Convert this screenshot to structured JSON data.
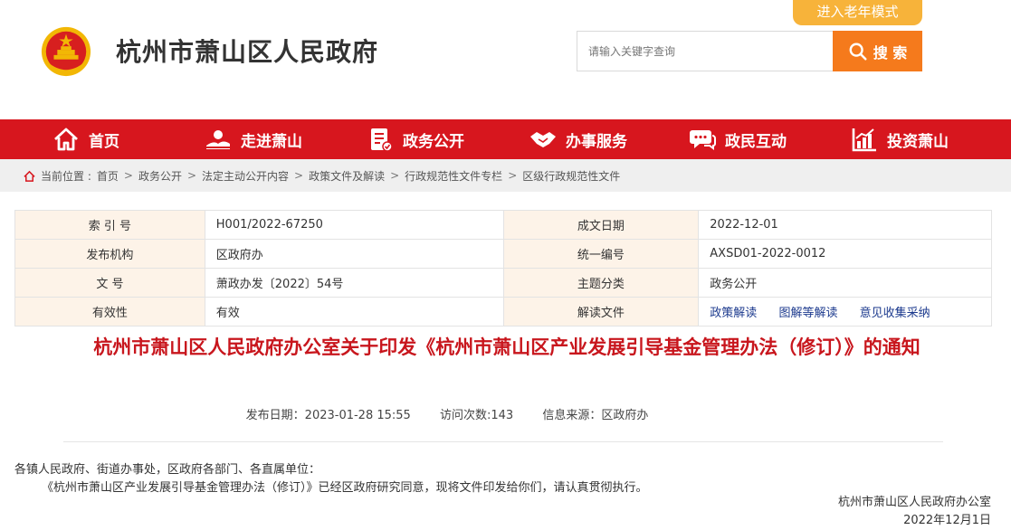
{
  "header": {
    "site_title": "杭州市萧山区人民政府",
    "elder_mode": "进入老年模式",
    "search_placeholder": "请输入关键字查询",
    "search_label": "搜 索"
  },
  "nav": [
    {
      "label": "首页",
      "icon": "home-icon"
    },
    {
      "label": "走进萧山",
      "icon": "landscape-icon"
    },
    {
      "label": "政务公开",
      "icon": "document-icon"
    },
    {
      "label": "办事服务",
      "icon": "handshake-icon"
    },
    {
      "label": "政民互动",
      "icon": "chat-icon"
    },
    {
      "label": "投资萧山",
      "icon": "chart-icon"
    }
  ],
  "breadcrumb": {
    "prefix": "当前位置 :",
    "items": [
      "首页",
      "政务公开",
      "法定主动公开内容",
      "政策文件及解读",
      "行政规范性文件专栏",
      "区级行政规范性文件"
    ]
  },
  "meta": {
    "rows": [
      {
        "l1": "索 引 号",
        "v1": "H001/2022-67250",
        "l2": "成文日期",
        "v2": "2022-12-01"
      },
      {
        "l1": "发布机构",
        "v1": "区政府办",
        "l2": "统一编号",
        "v2": "AXSD01-2022-0012"
      },
      {
        "l1": "文 号",
        "v1": "萧政办发〔2022〕54号",
        "l2": "主题分类",
        "v2": "政务公开"
      },
      {
        "l1": "有效性",
        "v1": "有效",
        "l2": "解读文件",
        "v2": ""
      }
    ],
    "interpretation_links": [
      "政策解读",
      "图解等解读",
      "意见收集采纳"
    ]
  },
  "article": {
    "title": "杭州市萧山区人民政府办公室关于印发《杭州市萧山区产业发展引导基金管理办法（修订）》的通知",
    "publish_date": "发布日期：2023-01-28 15:55",
    "visits": "访问次数:143",
    "source": "信息来源：区政府办",
    "salutation": "各镇人民政府、街道办事处，区政府各部门、各直属单位：",
    "paragraph": "《杭州市萧山区产业发展引导基金管理办法（修订）》已经区政府研究同意，现将文件印发给你们，请认真贯彻执行。",
    "sign_org": "杭州市萧山区人民政府办公室",
    "sign_date": "2022年12月1日"
  },
  "colors": {
    "brand_red": "#d7161e",
    "title_red": "#c8161d",
    "search_orange": "#f57a1c",
    "elder_yellow": "#f7b33a"
  }
}
